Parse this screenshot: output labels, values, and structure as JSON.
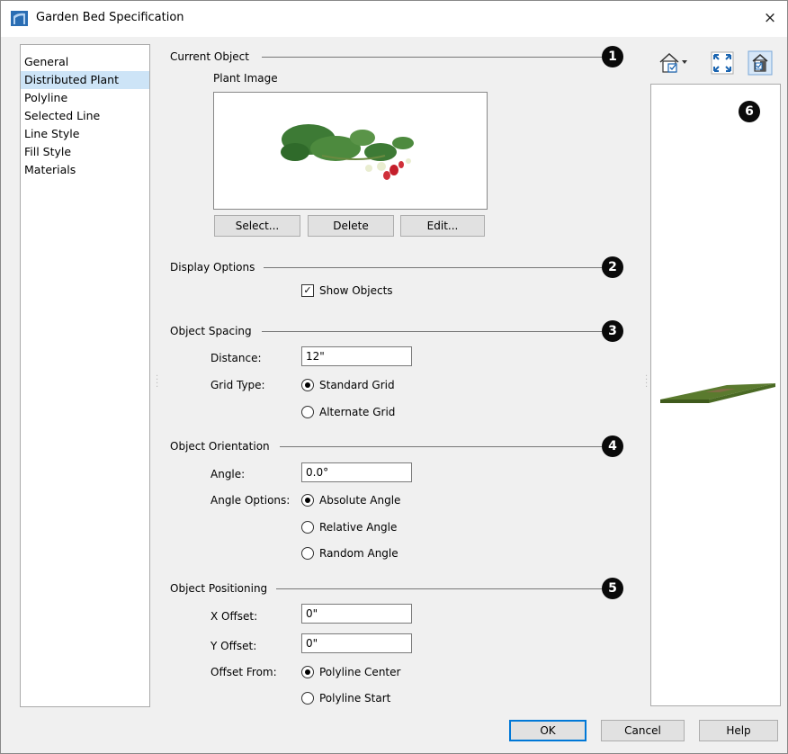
{
  "window": {
    "title": "Garden Bed Specification",
    "close_glyph": "×"
  },
  "sidebar": {
    "items": [
      {
        "label": "General"
      },
      {
        "label": "Distributed Plant",
        "selected": true
      },
      {
        "label": "Polyline"
      },
      {
        "label": "Selected Line"
      },
      {
        "label": "Line Style"
      },
      {
        "label": "Fill Style"
      },
      {
        "label": "Materials"
      }
    ]
  },
  "current_object": {
    "heading": "Current Object",
    "badge": "1",
    "image_label": "Plant Image",
    "image_content": "strawberry-plant",
    "select_label": "Select...",
    "delete_label": "Delete",
    "edit_label": "Edit..."
  },
  "display_options": {
    "heading": "Display Options",
    "badge": "2",
    "show_objects_label": "Show Objects",
    "show_objects_checked": true
  },
  "object_spacing": {
    "heading": "Object Spacing",
    "badge": "3",
    "distance_label": "Distance:",
    "distance_value": "12\"",
    "grid_type_label": "Grid Type:",
    "standard_grid_label": "Standard Grid",
    "alternate_grid_label": "Alternate Grid",
    "selected_grid": "standard"
  },
  "object_orientation": {
    "heading": "Object Orientation",
    "badge": "4",
    "angle_label": "Angle:",
    "angle_value": "0.0°",
    "angle_options_label": "Angle Options:",
    "absolute_label": "Absolute Angle",
    "relative_label": "Relative Angle",
    "random_label": "Random Angle",
    "selected_option": "absolute"
  },
  "object_positioning": {
    "heading": "Object Positioning",
    "badge": "5",
    "x_offset_label": "X Offset:",
    "x_offset_value": "0\"",
    "y_offset_label": "Y Offset:",
    "y_offset_value": "0\"",
    "offset_from_label": "Offset From:",
    "polyline_center_label": "Polyline Center",
    "polyline_start_label": "Polyline Start",
    "selected_offset": "center"
  },
  "preview": {
    "badge": "6",
    "toolbar_icons": [
      "view-options-icon",
      "fit-to-window-icon",
      "preview-toggle-icon"
    ],
    "content": "garden-bed-3d-slab"
  },
  "footer": {
    "ok_label": "OK",
    "cancel_label": "Cancel",
    "help_label": "Help"
  },
  "colors": {
    "accent": "#0078d7",
    "selection": "#cde4f7",
    "badge": "#0a0a0a",
    "slab_top": "#5a7a2e",
    "slab_side": "#3f5a1c"
  }
}
